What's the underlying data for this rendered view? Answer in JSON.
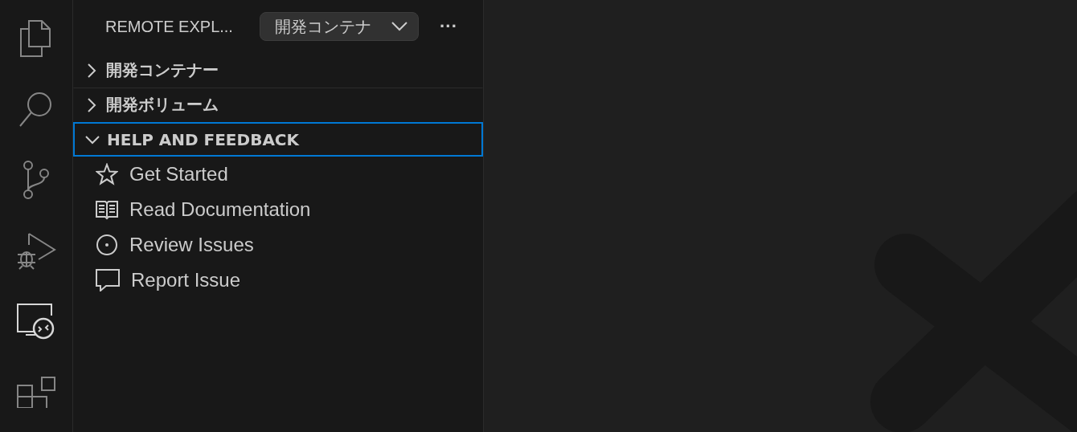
{
  "activity_bar": [
    {
      "kind": "files",
      "selected": false
    },
    {
      "kind": "search",
      "selected": false
    },
    {
      "kind": "branch",
      "selected": false
    },
    {
      "kind": "debug",
      "selected": false
    },
    {
      "kind": "remote",
      "selected": true
    },
    {
      "kind": "extensions",
      "selected": false
    }
  ],
  "sidebar": {
    "title": "REMOTE EXPL...",
    "dropdown": {
      "value": "開発コンテナ"
    },
    "more": "···",
    "sections": [
      {
        "label": "開発コンテナー",
        "expanded": false,
        "selected": false
      },
      {
        "label": "開発ボリューム",
        "expanded": false,
        "selected": false
      },
      {
        "label": "HELP AND FEEDBACK",
        "expanded": true,
        "selected": true,
        "items": [
          {
            "kind": "star",
            "label": "Get Started"
          },
          {
            "kind": "book",
            "label": "Read Documentation"
          },
          {
            "kind": "issues",
            "label": "Review Issues"
          },
          {
            "kind": "comment",
            "label": "Report Issue"
          }
        ]
      }
    ]
  }
}
